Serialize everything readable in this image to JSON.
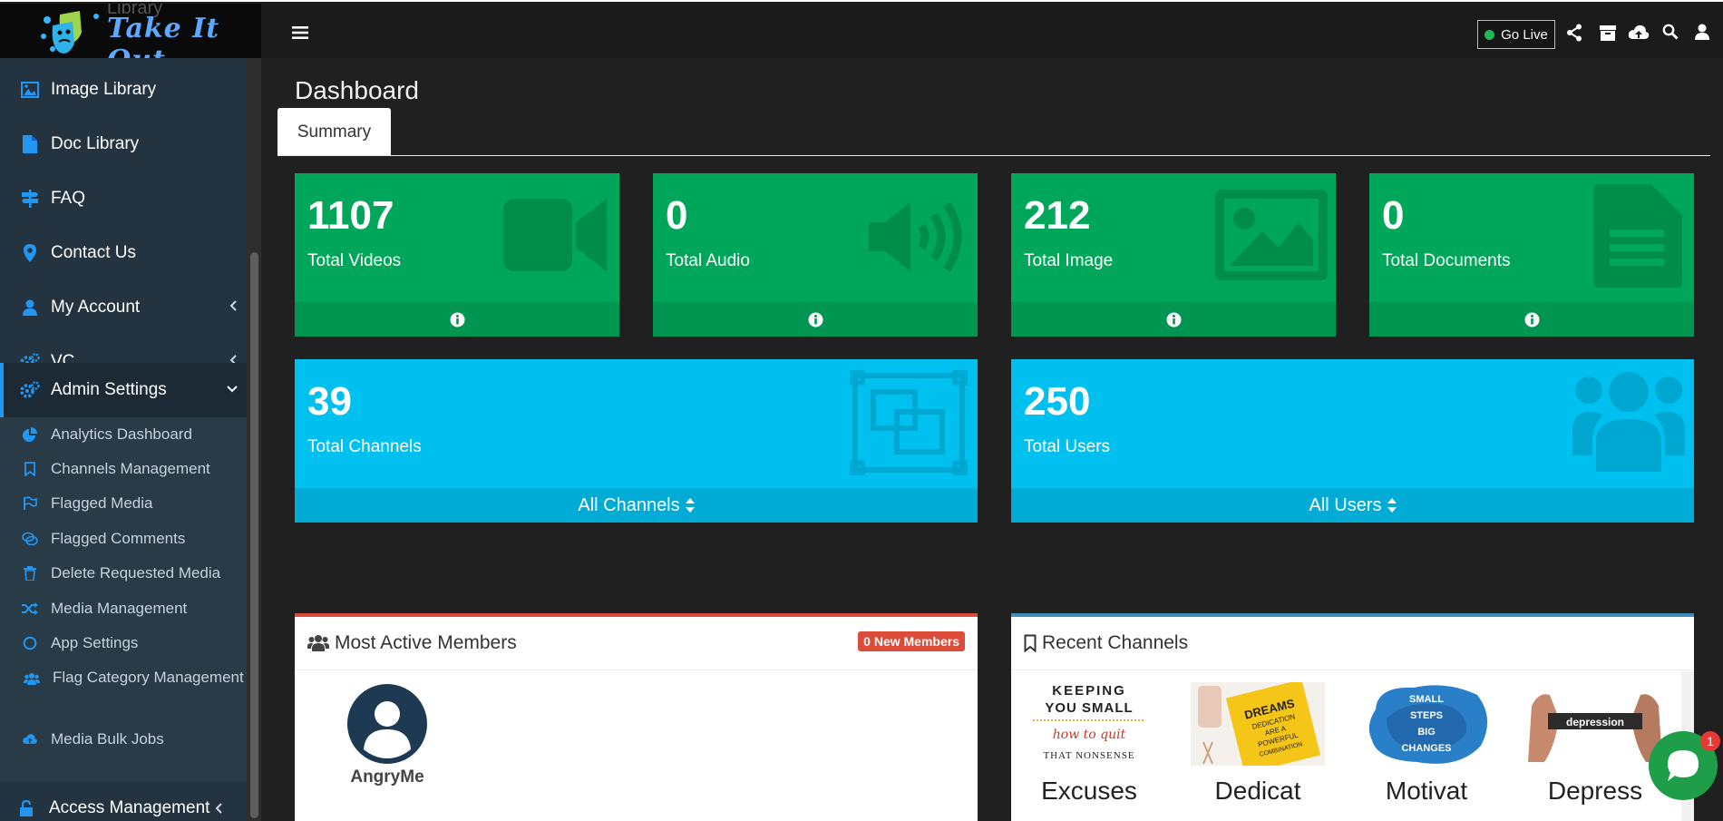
{
  "brand": {
    "name": "Take It Out",
    "ghost_text": "Library"
  },
  "header": {
    "go_live_label": "Go Live",
    "icons": [
      "share-icon",
      "archive-icon",
      "cloud-upload-icon",
      "search-icon",
      "user-icon"
    ]
  },
  "sidebar": {
    "items": [
      {
        "label": "Image Library",
        "icon": "image-icon"
      },
      {
        "label": "Doc Library",
        "icon": "document-icon"
      },
      {
        "label": "FAQ",
        "icon": "signpost-icon"
      },
      {
        "label": "Contact Us",
        "icon": "map-marker-icon"
      },
      {
        "label": "My Account",
        "icon": "user-icon"
      },
      {
        "label": "VC",
        "icon": "cogs-icon"
      },
      {
        "label": "Admin Settings",
        "icon": "cogs-icon"
      }
    ],
    "sub_items": [
      {
        "label": "Analytics Dashboard",
        "icon": "pie-chart-icon"
      },
      {
        "label": "Channels Management",
        "icon": "bookmark-icon"
      },
      {
        "label": "Flagged Media",
        "icon": "flag-icon"
      },
      {
        "label": "Flagged Comments",
        "icon": "comments-icon"
      },
      {
        "label": "Delete Requested Media",
        "icon": "trash-icon"
      },
      {
        "label": "Media Management",
        "icon": "shuffle-icon"
      },
      {
        "label": "App Settings",
        "icon": "circle-icon"
      },
      {
        "label": "Flag Category Management",
        "icon": "users-icon"
      },
      {
        "label": "Media Bulk Jobs",
        "icon": "cloud-upload-icon"
      }
    ],
    "access_label": "Access Management"
  },
  "main": {
    "title": "Dashboard",
    "tab": "Summary",
    "stats": [
      {
        "value": "1107",
        "label": "Total Videos",
        "icon": "video-camera-icon"
      },
      {
        "value": "0",
        "label": "Total Audio",
        "icon": "volume-icon"
      },
      {
        "value": "212",
        "label": "Total Image",
        "icon": "image-icon"
      },
      {
        "value": "0",
        "label": "Total Documents",
        "icon": "file-text-icon"
      }
    ],
    "big_stats": [
      {
        "value": "39",
        "label": "Total Channels",
        "footer": "All Channels",
        "icon": "object-group-icon"
      },
      {
        "value": "250",
        "label": "Total Users",
        "footer": "All Users",
        "icon": "users-icon"
      }
    ],
    "members_panel": {
      "title": "Most Active Members",
      "badge": "0 New Members",
      "members": [
        {
          "name": "AngryMe"
        }
      ]
    },
    "channels_panel": {
      "title": "Recent Channels",
      "channels": [
        {
          "name": "Excuses",
          "thumb_lines": [
            "KEEPING",
            "YOU SMALL",
            "how to quit",
            "THAT NONSENSE"
          ]
        },
        {
          "name": "Dedicat",
          "thumb_lines": [
            "DREAMS",
            "DEDICATION",
            "ARE A",
            "POWERFUL",
            "COMBINATION"
          ]
        },
        {
          "name": "Motivat",
          "thumb_lines": [
            "SMALL",
            "STEPS",
            "BIG",
            "CHANGES"
          ]
        },
        {
          "name": "Depress",
          "thumb_lines": [
            "depression"
          ]
        }
      ]
    }
  },
  "chat": {
    "unread": "1"
  },
  "colors": {
    "green": "#00a65a",
    "blue": "#00c0ef",
    "sidebar": "#233340",
    "badge": "#dd4b39",
    "panel_accent_red": "#dd4b39",
    "panel_accent_blue": "#3c8dbc"
  }
}
